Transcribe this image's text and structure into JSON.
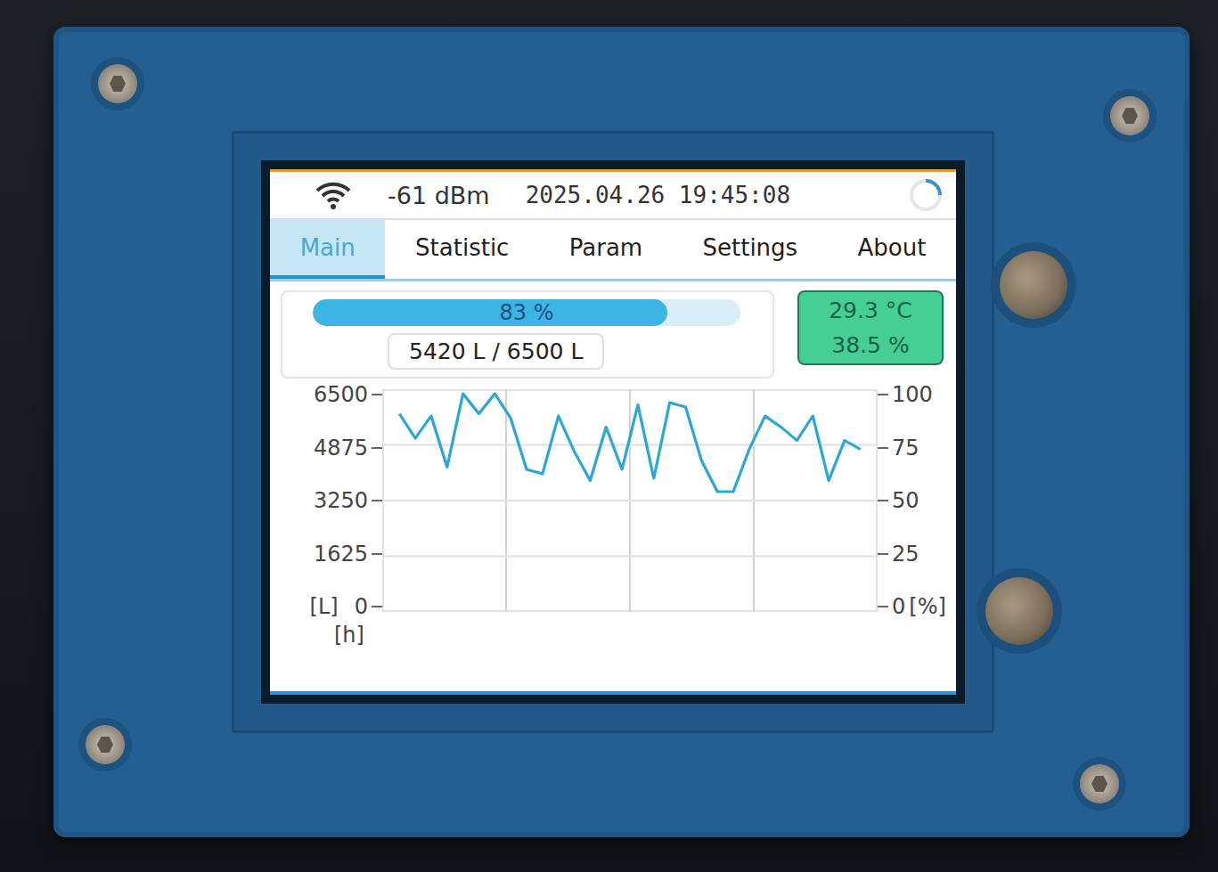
{
  "status_bar": {
    "signal": "-61 dBm",
    "datetime": "2025.04.26 19:45:08"
  },
  "tabs": [
    {
      "label": "Main",
      "selected": true
    },
    {
      "label": "Statistic",
      "selected": false
    },
    {
      "label": "Param",
      "selected": false
    },
    {
      "label": "Settings",
      "selected": false
    },
    {
      "label": "About",
      "selected": false
    }
  ],
  "tank": {
    "level": 0.83,
    "percent": "83 %",
    "volume": "5420 L / 6500 L"
  },
  "climate": {
    "temperature": "29.3 °C",
    "humidity": "38.5 %"
  },
  "chart": {
    "left_ticks": [
      "6500",
      "4875",
      "3250",
      "1625",
      "0"
    ],
    "left_unit": "[L]",
    "right_ticks": [
      "100",
      "75",
      "50",
      "25",
      "0"
    ],
    "right_unit": "[%]",
    "x_unit": "[h]",
    "series": [
      {
        "values": [
          89,
          78,
          88,
          65,
          98,
          89,
          98,
          87,
          64,
          62,
          88,
          72,
          59,
          83,
          64,
          93,
          60,
          94,
          92,
          68,
          54,
          54,
          73,
          88,
          83,
          77,
          88,
          59,
          77,
          73
        ]
      }
    ]
  }
}
